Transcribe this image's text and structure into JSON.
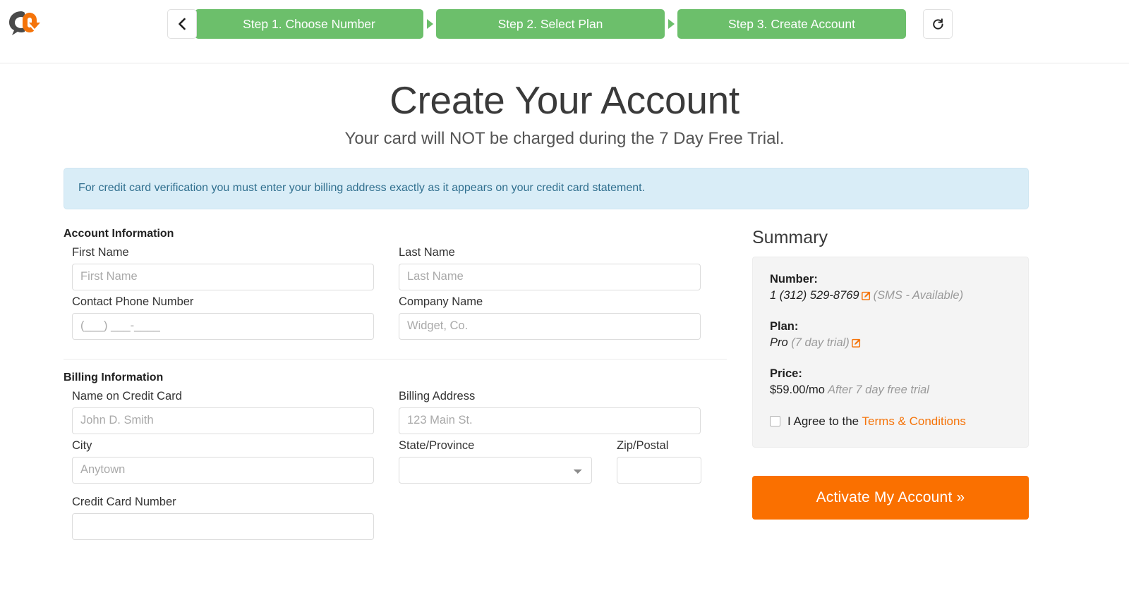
{
  "header": {
    "logo_name": "callsource-logo",
    "back_button_icon": "chevron-left-icon",
    "restart_button_icon": "restart-arrow-icon",
    "steps": [
      {
        "label": "Step 1. Choose Number"
      },
      {
        "label": "Step 2. Select Plan"
      },
      {
        "label": "Step 3. Create Account"
      }
    ]
  },
  "page": {
    "title": "Create Your Account",
    "subtitle": "Your card will NOT be charged during the 7 Day Free Trial.",
    "alert": "For credit card verification you must enter your billing address exactly as it appears on your credit card statement."
  },
  "account_information": {
    "section_title": "Account Information",
    "first_name": {
      "label": "First Name",
      "placeholder": "First Name",
      "value": ""
    },
    "last_name": {
      "label": "Last Name",
      "placeholder": "Last Name",
      "value": ""
    },
    "contact_phone": {
      "label": "Contact Phone Number",
      "placeholder": "(___) ___-____",
      "value": ""
    },
    "company_name": {
      "label": "Company Name",
      "placeholder": "Widget, Co.",
      "value": ""
    }
  },
  "billing_information": {
    "section_title": "Billing Information",
    "name_on_card": {
      "label": "Name on Credit Card",
      "placeholder": "John D. Smith",
      "value": ""
    },
    "billing_address": {
      "label": "Billing Address",
      "placeholder": "123 Main St.",
      "value": ""
    },
    "city": {
      "label": "City",
      "placeholder": "Anytown",
      "value": ""
    },
    "state": {
      "label": "State/Province",
      "selected": "",
      "options": [
        ""
      ]
    },
    "zip": {
      "label": "Zip/Postal",
      "placeholder": "",
      "value": ""
    },
    "credit_card_number": {
      "label": "Credit Card Number",
      "placeholder": "",
      "value": ""
    }
  },
  "summary": {
    "title": "Summary",
    "number_label": "Number:",
    "number_value": "1 (312) 529-8769",
    "number_note": "(SMS - Available)",
    "number_edit_icon": "edit-pencil-icon",
    "plan_label": "Plan:",
    "plan_value": "Pro",
    "plan_note": "(7 day trial)",
    "plan_edit_icon": "edit-pencil-icon",
    "price_label": "Price:",
    "price_value": "$59.00/mo",
    "price_note": "After 7 day free trial",
    "agree_prefix": "I Agree to the ",
    "terms_link": "Terms & Conditions",
    "activate_label": "Activate My Account »"
  },
  "colors": {
    "step_green": "#6cbf6b",
    "accent_orange": "#fa7000",
    "link_orange": "#f5740a",
    "alert_bg": "#d9edf7",
    "alert_text": "#31708f",
    "summary_bg": "#f4f4f4"
  }
}
